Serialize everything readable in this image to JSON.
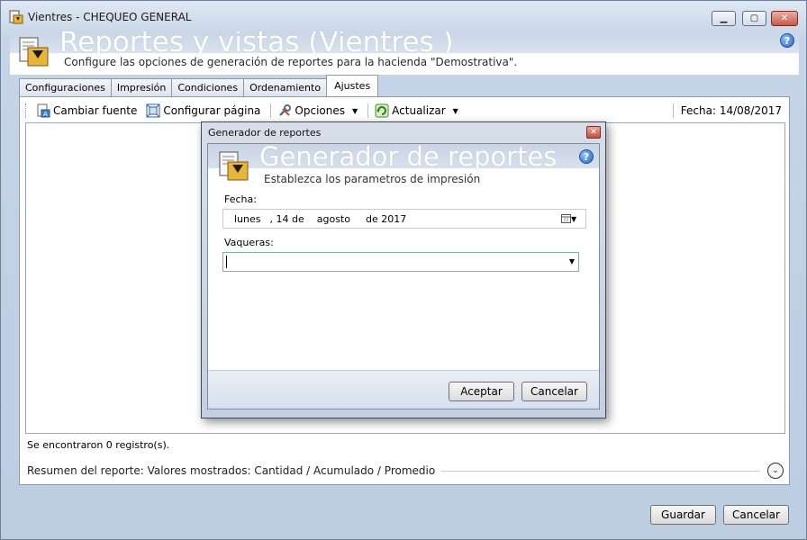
{
  "window": {
    "title": "Vientres  - CHEQUEO GENERAL",
    "icon": "report-icon",
    "controls": {
      "minimize": "▁",
      "maximize": "▢",
      "close": "✕"
    }
  },
  "header": {
    "title": "Reportes y vistas (Vientres )",
    "subtitle": "Configure las opciones de generación de reportes para la hacienda \"Demostrativa\".",
    "help": "?"
  },
  "tabs": [
    {
      "label": "Configuraciones",
      "active": false
    },
    {
      "label": "Impresión",
      "active": false
    },
    {
      "label": "Condiciones",
      "active": false
    },
    {
      "label": "Ordenamiento",
      "active": false
    },
    {
      "label": "Ajustes",
      "active": true
    }
  ],
  "toolbar": {
    "cambiar_fuente": "Cambiar fuente",
    "configurar_pagina": "Configurar página",
    "opciones": "Opciones",
    "actualizar": "Actualizar",
    "dropdown_arrow": "▼",
    "fecha": "Fecha: 14/08/2017"
  },
  "status": {
    "records": "Se encontraron 0 registro(s).",
    "summary": "Resumen del reporte: Valores mostrados:  Cantidad / Acumulado / Promedio",
    "expand": "⌄"
  },
  "footer": {
    "guardar": "Guardar",
    "cancelar": "Cancelar"
  },
  "dialog": {
    "title": "Generador de reportes",
    "close": "✕",
    "header_title": "Generador de reportes",
    "header_subtitle": "Establezca los parametros de impresión",
    "help": "?",
    "fecha_label": "Fecha:",
    "date": {
      "weekday": "lunes",
      "day": ", 14 de",
      "month": "agosto",
      "year": "de 2017"
    },
    "vaqueras_label": "Vaqueras:",
    "vaqueras_value": "",
    "aceptar": "Aceptar",
    "cancelar": "Cancelar",
    "dropdown_arrow": "▼"
  },
  "colors": {
    "window_bg": "#c6d5e7",
    "panel_bg": "#ffffff",
    "header_text": "#ffffff"
  }
}
